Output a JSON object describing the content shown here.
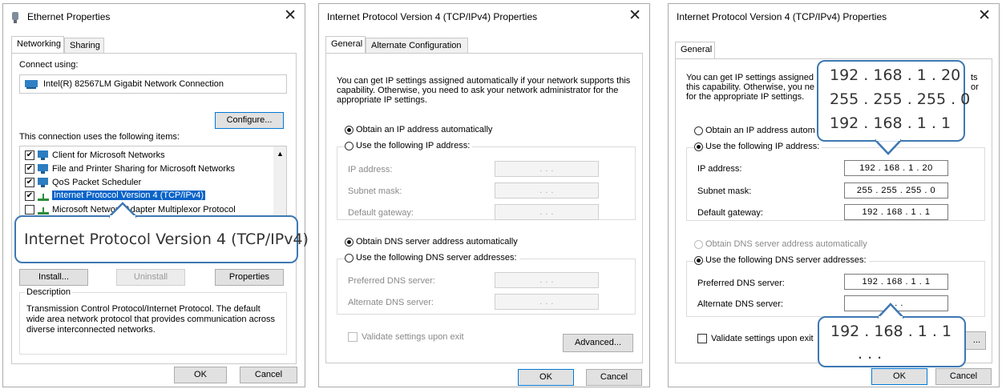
{
  "d1": {
    "title": "Ethernet Properties",
    "tabs": [
      "Networking",
      "Sharing"
    ],
    "connect_using_label": "Connect using:",
    "adapter": "Intel(R) 82567LM Gigabit Network Connection",
    "configure_label": "Configure...",
    "items_label": "This connection uses the following items:",
    "items": [
      {
        "label": "Client for Microsoft Networks",
        "checked": true
      },
      {
        "label": "File and Printer Sharing for Microsoft Networks",
        "checked": true
      },
      {
        "label": "QoS Packet Scheduler",
        "checked": true
      },
      {
        "label": "Internet Protocol Version 4 (TCP/IPv4)",
        "checked": true
      },
      {
        "label": "Microsoft Network Adapter Multiplexor Protocol",
        "checked": false
      }
    ],
    "callout_text": "Internet Protocol Version 4 (TCP/IPv4)",
    "install_label": "Install...",
    "uninstall_label": "Uninstall",
    "properties_label": "Properties",
    "description_label": "Description",
    "description_text": "Transmission Control Protocol/Internet Protocol. The default wide area network protocol that provides communication across diverse interconnected networks.",
    "ok_label": "OK",
    "cancel_label": "Cancel"
  },
  "d2": {
    "title": "Internet Protocol Version 4 (TCP/IPv4) Properties",
    "tabs": [
      "General",
      "Alternate Configuration"
    ],
    "intro": "You can get IP settings assigned automatically if your network supports this capability. Otherwise, you need to ask your network administrator for the appropriate IP settings.",
    "auto_ip_label": "Obtain an IP address automatically",
    "manual_ip_label": "Use the following IP address:",
    "ip_label": "IP address:",
    "mask_label": "Subnet mask:",
    "gateway_label": "Default gateway:",
    "empty_ip": ".       .       .",
    "auto_dns_label": "Obtain DNS server address automatically",
    "manual_dns_label": "Use the following DNS server addresses:",
    "pref_dns_label": "Preferred DNS server:",
    "alt_dns_label": "Alternate DNS server:",
    "validate_label": "Validate settings upon exit",
    "advanced_label": "Advanced...",
    "ok_label": "OK",
    "cancel_label": "Cancel"
  },
  "d3": {
    "title": "Internet Protocol Version 4 (TCP/IPv4) Properties",
    "tabs": [
      "General"
    ],
    "intro_lines": [
      "You can get IP settings assigned",
      "this capability. Otherwise, you ne",
      "for the appropriate IP settings."
    ],
    "intro_tails": [
      "ts",
      "or"
    ],
    "auto_ip_label": "Obtain an IP address autom",
    "manual_ip_label": "Use the following IP address:",
    "ip_label": "IP address:",
    "mask_label": "Subnet mask:",
    "gateway_label": "Default gateway:",
    "ip_value": "192 . 168 . 1 . 20",
    "mask_value": "255 . 255 . 255 . 0",
    "gateway_value": "192 . 168 . 1 . 1",
    "auto_dns_label": "Obtain DNS server address automatically",
    "manual_dns_label": "Use the following DNS server addresses:",
    "pref_dns_label": "Preferred DNS server:",
    "alt_dns_label": "Alternate DNS server:",
    "pref_dns_value": "192 . 168 . 1 . 1",
    "alt_dns_value": ".       .       .",
    "validate_label": "Validate settings upon exit",
    "advanced_partial": "...",
    "callout_top": [
      "192 . 168 . 1 . 20",
      "255 . 255 . 255 . 0",
      "192 . 168 . 1 . 1"
    ],
    "callout_bottom": [
      "192 . 168 . 1 . 1",
      ".       .       ."
    ],
    "ok_label": "OK",
    "cancel_label": "Cancel"
  }
}
